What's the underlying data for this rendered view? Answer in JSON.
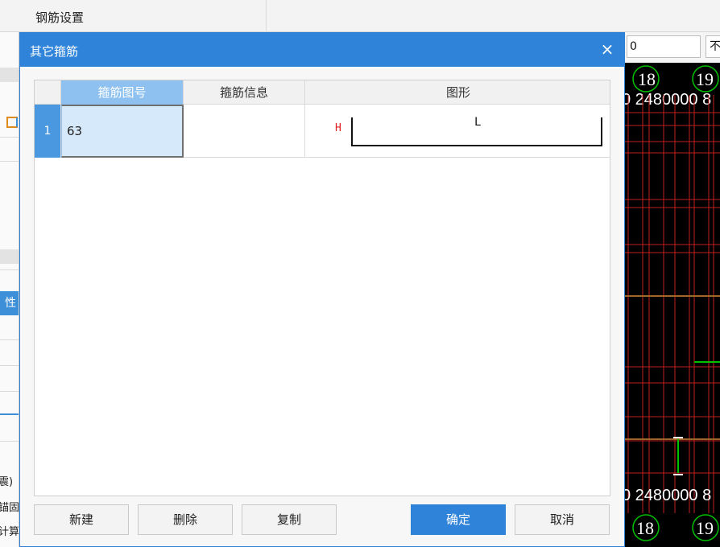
{
  "menubar": {
    "title": "钢筋设置"
  },
  "left_panel": {
    "blue_row_text": "性",
    "bottom_texts": [
      "震)",
      "锚固",
      "计算"
    ]
  },
  "right_panel": {
    "input1_value": "0",
    "input2_value": "不",
    "cad_labels": {
      "top_row": [
        "18",
        "19"
      ],
      "top_dims": "0 2480000 8",
      "bottom_dims": "0 2480000 8",
      "bottom_row": [
        "18",
        "19"
      ]
    }
  },
  "dialog": {
    "title": "其它箍筋",
    "close_label": "×",
    "table": {
      "columns": [
        "箍筋图号",
        "箍筋信息",
        "图形"
      ],
      "rows": [
        {
          "index": "1",
          "figure_no": "63",
          "info": "",
          "shape": {
            "h_label": "H",
            "l_label": "L"
          }
        }
      ]
    },
    "buttons": {
      "new": "新建",
      "delete": "删除",
      "copy": "复制",
      "ok": "确定",
      "cancel": "取消"
    }
  },
  "colors": {
    "accent": "#2f84d9",
    "selected_header": "#8ec1ef",
    "row_number": "#4a98e0",
    "shape_h": "#e02020"
  }
}
